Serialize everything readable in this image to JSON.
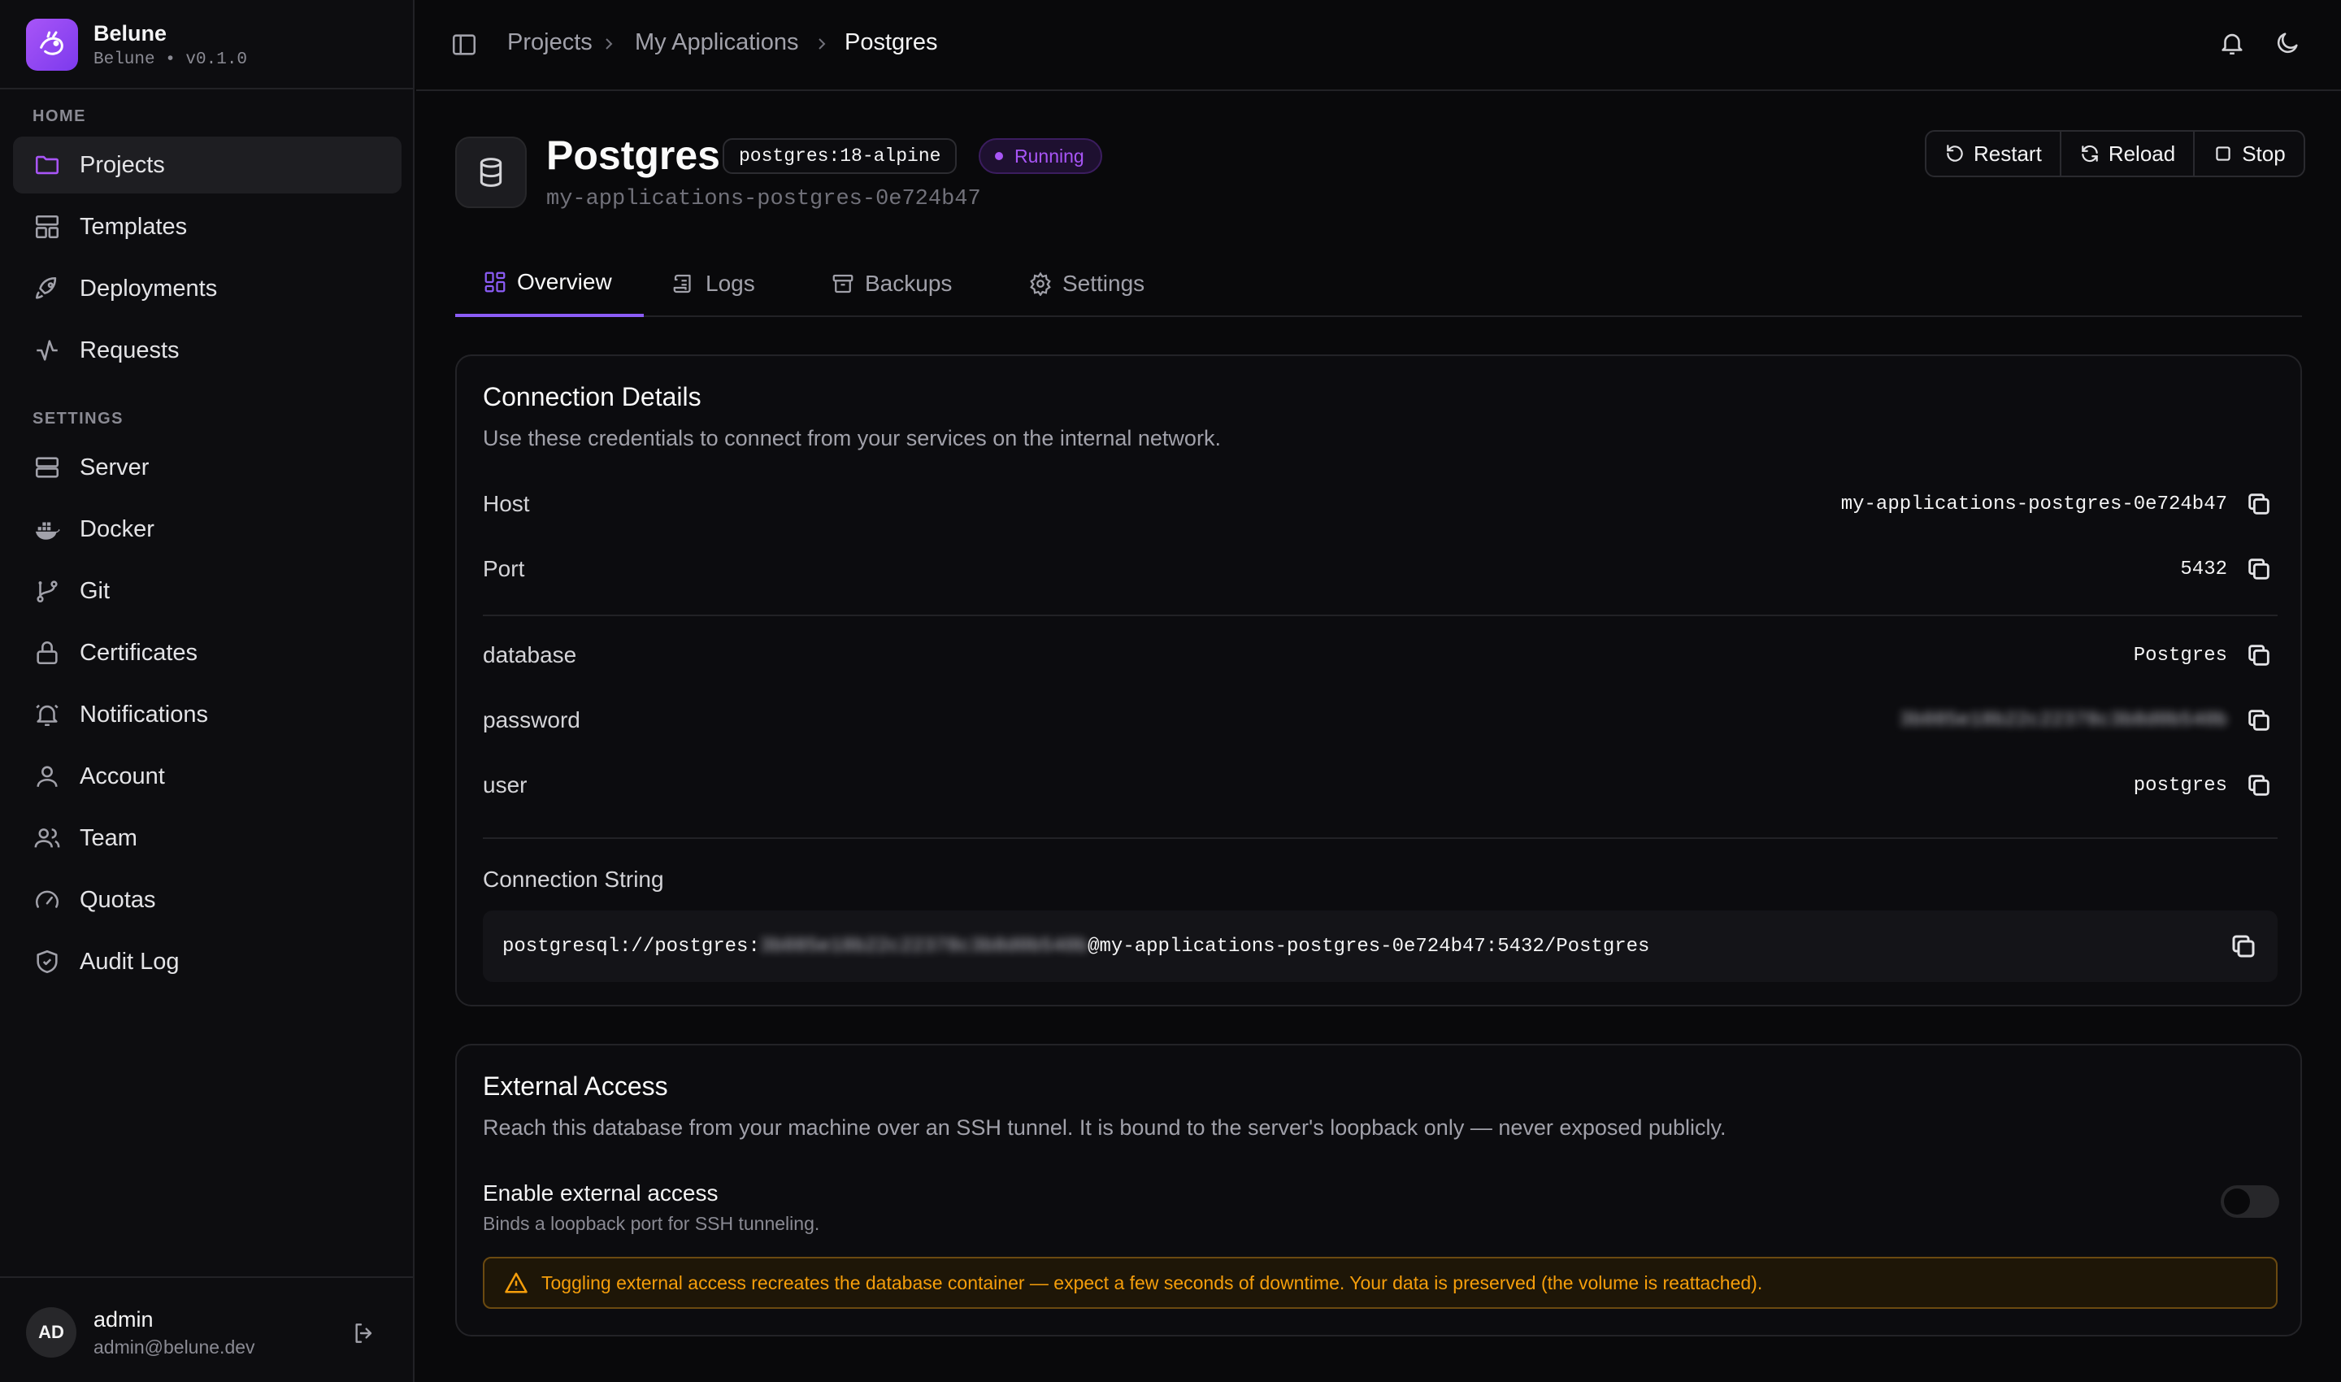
{
  "brand": {
    "name": "Belune",
    "subtitle": "Belune • v0.1.0"
  },
  "sidebar": {
    "home_label": "HOME",
    "settings_label": "SETTINGS",
    "home_items": [
      {
        "label": "Projects",
        "icon": "folder-icon",
        "active": true
      },
      {
        "label": "Templates",
        "icon": "layout-icon"
      },
      {
        "label": "Deployments",
        "icon": "rocket-icon"
      },
      {
        "label": "Requests",
        "icon": "activity-icon"
      }
    ],
    "settings_items": [
      {
        "label": "Server",
        "icon": "server-icon"
      },
      {
        "label": "Docker",
        "icon": "docker-icon"
      },
      {
        "label": "Git",
        "icon": "git-branch-icon"
      },
      {
        "label": "Certificates",
        "icon": "lock-icon"
      },
      {
        "label": "Notifications",
        "icon": "bell-icon"
      },
      {
        "label": "Account",
        "icon": "user-icon"
      },
      {
        "label": "Team",
        "icon": "users-icon"
      },
      {
        "label": "Quotas",
        "icon": "gauge-icon"
      },
      {
        "label": "Audit Log",
        "icon": "shield-check-icon"
      }
    ]
  },
  "user": {
    "initials": "AD",
    "name": "admin",
    "email": "admin@belune.dev"
  },
  "breadcrumb": [
    "Projects",
    "My Applications",
    "Postgres"
  ],
  "service": {
    "title": "Postgres",
    "image": "postgres:18-alpine",
    "status": "Running",
    "container": "my-applications-postgres-0e724b47"
  },
  "actions": [
    "Restart",
    "Reload",
    "Stop"
  ],
  "tabs": [
    "Overview",
    "Logs",
    "Backups",
    "Settings"
  ],
  "connection": {
    "title": "Connection Details",
    "description": "Use these credentials to connect from your services on the internal network.",
    "rows": [
      {
        "key": "Host",
        "value": "my-applications-postgres-0e724b47"
      },
      {
        "key": "Port",
        "value": "5432"
      },
      {
        "key": "database",
        "value": "Postgres"
      },
      {
        "key": "password",
        "value": "3b085e18b22c22378c3b8d0b540b",
        "masked": true
      },
      {
        "key": "user",
        "value": "postgres"
      }
    ],
    "string_label": "Connection String",
    "string_prefix": "postgresql://postgres:",
    "string_password": "3b085e18b22c22378c3b8d0b540b",
    "string_suffix": "@my-applications-postgres-0e724b47:5432/Postgres"
  },
  "external": {
    "title": "External Access",
    "description": "Reach this database from your machine over an SSH tunnel. It is bound to the server's loopback only — never exposed publicly.",
    "toggle_label": "Enable external access",
    "toggle_hint": "Binds a loopback port for SSH tunneling.",
    "enabled": false,
    "warning": "Toggling external access recreates the database container — expect a few seconds of downtime. Your data is preserved (the volume is reattached)."
  },
  "colors": {
    "accent": "#8b5cf6",
    "warning": "#f59e0b",
    "background": "#09090b"
  }
}
